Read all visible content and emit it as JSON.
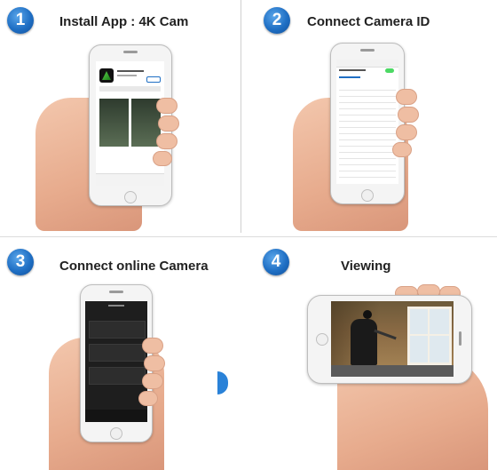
{
  "steps": [
    {
      "number": "1",
      "title": "Install App : 4K Cam"
    },
    {
      "number": "2",
      "title": "Connect Camera ID"
    },
    {
      "number": "3",
      "title": "Connect online Camera"
    },
    {
      "number": "4",
      "title": "Viewing"
    }
  ],
  "colors": {
    "badge": "#1f6fc4",
    "wifi_on": "#4cd964",
    "dark_screen": "#1e1e1e"
  }
}
